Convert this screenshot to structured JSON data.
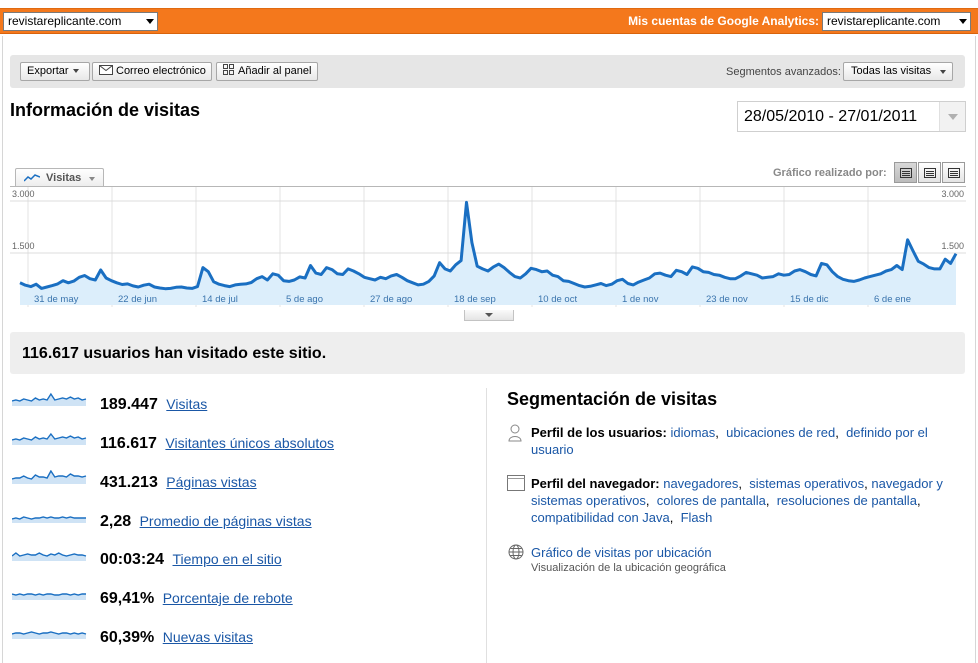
{
  "topbar": {
    "site_select": "revistareplicante.com",
    "accounts_label": "Mis cuentas de Google Analytics:",
    "account_select": "revistareplicante.com"
  },
  "toolbar": {
    "export": "Exportar",
    "email": "Correo electrónico",
    "dashboard": "Añadir al panel",
    "segments_label": "Segmentos avanzados:",
    "segments_value": "Todas las visitas"
  },
  "page": {
    "title": "Información de visitas",
    "date_range": "28/05/2010 - 27/01/2011",
    "metric_tab": "Visitas",
    "graph_by": "Gráfico realizado por:"
  },
  "chart_data": {
    "type": "area",
    "ylim": [
      0,
      3000
    ],
    "y_ticks": [
      "3.000",
      "1.500"
    ],
    "x_labels": [
      "31 de may",
      "22 de jun",
      "14 de jul",
      "5 de ago",
      "27 de ago",
      "18 de sep",
      "10 de oct",
      "1 de nov",
      "23 de nov",
      "15 de dic",
      "6 de ene"
    ],
    "series": [
      {
        "values": [
          640,
          570,
          530,
          600,
          480,
          520,
          560,
          610,
          700,
          640,
          690,
          800,
          850,
          760,
          720,
          1010,
          780,
          700,
          640,
          590,
          610,
          550,
          520,
          570,
          600,
          520,
          490,
          470,
          480,
          510,
          520,
          490,
          480,
          530,
          1080,
          960,
          670,
          600,
          560,
          530,
          580,
          600,
          610,
          650,
          760,
          820,
          720,
          900,
          860,
          700,
          680,
          720,
          810,
          780,
          1140,
          920,
          880,
          1080,
          1020,
          900,
          880,
          1040,
          980,
          900,
          800,
          760,
          720,
          800,
          760,
          840,
          880,
          800,
          700,
          640,
          580,
          600,
          680,
          840,
          1220,
          1040,
          980,
          1160,
          1280,
          2960,
          1800,
          1120,
          1040,
          980,
          1100,
          1180,
          1080,
          940,
          820,
          780,
          900,
          1060,
          1020,
          960,
          980,
          860,
          820,
          700,
          680,
          620,
          560,
          520,
          540,
          580,
          620,
          560,
          600,
          700,
          740,
          620,
          580,
          660,
          720,
          780,
          900,
          920,
          860,
          820,
          1000,
          960,
          880,
          1100,
          1060,
          960,
          940,
          880,
          860,
          800,
          760,
          760,
          840,
          940,
          900,
          860,
          780,
          800,
          820,
          900,
          860,
          880,
          980,
          1020,
          960,
          880,
          840,
          1200,
          1160,
          960,
          820,
          740,
          700,
          680,
          720,
          780,
          820,
          860,
          900,
          980,
          1020,
          1140,
          1020,
          1880,
          1560,
          1260,
          1180,
          1080,
          1040,
          1040,
          1320,
          1200,
          1480
        ]
      }
    ]
  },
  "summary": {
    "text": "116.617 usuarios han visitado este sitio."
  },
  "stats": [
    {
      "value": "189.447",
      "label": "Visitas"
    },
    {
      "value": "116.617",
      "label": "Visitantes únicos absolutos"
    },
    {
      "value": "431.213",
      "label": "Páginas vistas"
    },
    {
      "value": "2,28",
      "label": "Promedio de páginas vistas"
    },
    {
      "value": "00:03:24",
      "label": "Tiempo en el sitio"
    },
    {
      "value": "69,41%",
      "label": "Porcentaje de rebote"
    },
    {
      "value": "60,39%",
      "label": "Nuevas visitas"
    }
  ],
  "segmentation": {
    "title": "Segmentación de visitas",
    "users_label": "Perfil de los usuarios:",
    "users_links": [
      "idiomas",
      "ubicaciones de red",
      "definido por el usuario"
    ],
    "browser_label": "Perfil del navegador:",
    "browser_links": [
      "navegadores",
      "sistemas operativos",
      "navegador y sistemas operativos",
      "colores de pantalla",
      "resoluciones de pantalla",
      "compatibilidad con Java",
      "Flash"
    ],
    "geo_link": "Gráfico de visitas por ubicación",
    "geo_sub": "Visualización de la ubicación geográfica"
  },
  "colors": {
    "topbar": "#f4781c",
    "line": "#1a6fc2",
    "link": "#1a57a6"
  }
}
